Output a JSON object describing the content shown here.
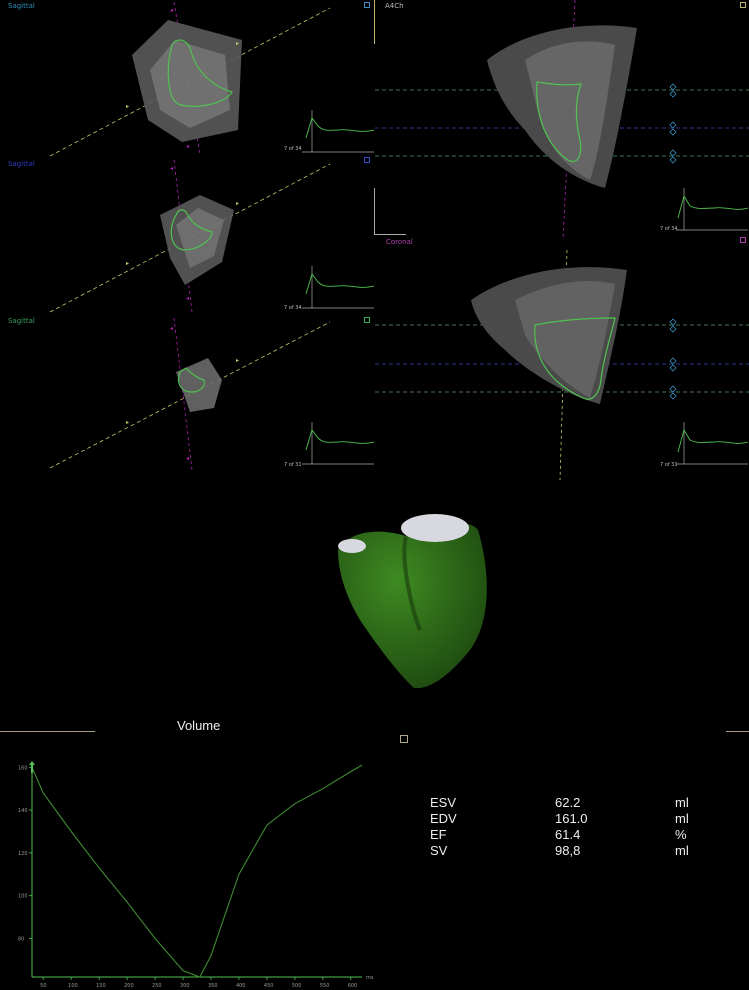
{
  "views": {
    "sagittal_1": "Sagittal",
    "sagittal_2": "Sagittal",
    "sagittal_3": "Sagittal",
    "a4ch": "A4Ch",
    "coronal": "Coronal"
  },
  "frame_labels": {
    "f1": "7 of 34",
    "f2": "7 of 34",
    "f3": "7 of 31",
    "f4": "7 of 34",
    "f5": "7 of 31"
  },
  "volume_title": "Volume",
  "results": [
    {
      "name": "ESV",
      "value": "62.2",
      "unit": "ml"
    },
    {
      "name": "EDV",
      "value": "161.0",
      "unit": "ml"
    },
    {
      "name": "EF",
      "value": "61.4",
      "unit": "%"
    },
    {
      "name": "SV",
      "value": "98,8",
      "unit": "ml"
    }
  ],
  "colors": {
    "sagittal_label": "#2e8fb5",
    "sagittal_label_2": "#2a3ec0",
    "sagittal_label_3": "#3aa05a",
    "coronal_label": "#b040b0",
    "contour": "#4fc24f",
    "mesh": "#2f6b1a"
  },
  "chart_data": {
    "type": "line",
    "title": "Volume",
    "xlabel": "ms",
    "ylabel": "",
    "x_ticks": [
      "50",
      "100",
      "150",
      "200",
      "250",
      "300",
      "350",
      "400",
      "450",
      "500",
      "550",
      "600"
    ],
    "y_ticks": [
      "80",
      "100",
      "120",
      "140",
      "160"
    ],
    "xlim": [
      30,
      620
    ],
    "ylim": [
      62,
      162
    ],
    "x": [
      30,
      50,
      100,
      150,
      200,
      250,
      300,
      330,
      350,
      400,
      450,
      500,
      550,
      600,
      620
    ],
    "y": [
      160,
      148,
      130,
      113,
      97,
      80,
      65,
      62,
      72,
      110,
      133,
      143,
      150,
      158,
      161
    ]
  }
}
